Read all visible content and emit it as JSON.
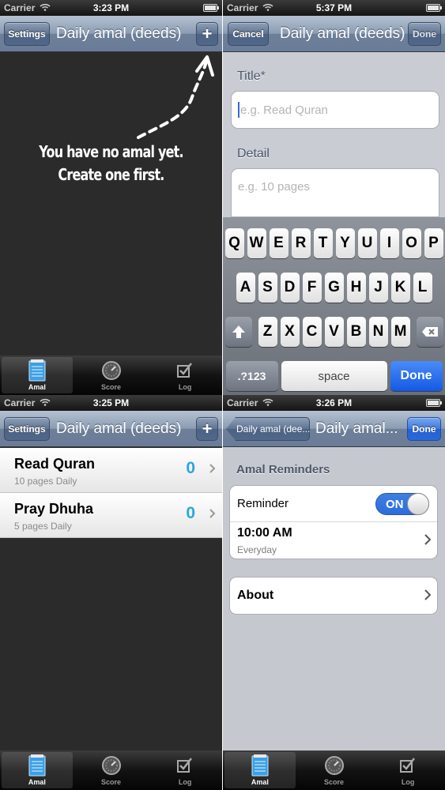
{
  "common": {
    "carrier": "Carrier",
    "tabs": [
      "Amal",
      "Score",
      "Log"
    ]
  },
  "p1": {
    "time": "3:23 PM",
    "left_button": "Settings",
    "title": "Daily amal (deeds)",
    "right_button": "+",
    "empty_line1": "You have no amal yet.",
    "empty_line2": "Create one first."
  },
  "p2": {
    "time": "5:37 PM",
    "left_button": "Cancel",
    "title": "Daily amal (deeds)",
    "right_button": "Done",
    "title_label": "Title*",
    "title_placeholder": "e.g. Read Quran",
    "detail_label": "Detail",
    "detail_placeholder": "e.g. 10 pages",
    "keyboard": {
      "row1": [
        "Q",
        "W",
        "E",
        "R",
        "T",
        "Y",
        "U",
        "I",
        "O",
        "P"
      ],
      "row2": [
        "A",
        "S",
        "D",
        "F",
        "G",
        "H",
        "J",
        "K",
        "L"
      ],
      "row3": [
        "Z",
        "X",
        "C",
        "V",
        "B",
        "N",
        "M"
      ],
      "numbers_key": ".?123",
      "space_key": "space",
      "done_key": "Done"
    }
  },
  "p3": {
    "time": "3:25 PM",
    "left_button": "Settings",
    "title": "Daily amal (deeds)",
    "right_button": "+",
    "items": [
      {
        "title": "Read Quran",
        "detail": "10 pages Daily",
        "count": "0"
      },
      {
        "title": "Pray Dhuha",
        "detail": "5 pages Daily",
        "count": "0"
      }
    ]
  },
  "p4": {
    "time": "3:26 PM",
    "back_button": "Daily amal (dee...",
    "title": "Daily amal...",
    "right_button": "Done",
    "section_header": "Amal Reminders",
    "reminder_label": "Reminder",
    "toggle_label": "ON",
    "reminder_time": "10:00 AM",
    "reminder_repeat": "Everyday",
    "about_label": "About"
  },
  "colors": {
    "nav_blue": "#6d7f99",
    "done_blue": "#2562d4",
    "count_blue": "#2ca6e0"
  }
}
